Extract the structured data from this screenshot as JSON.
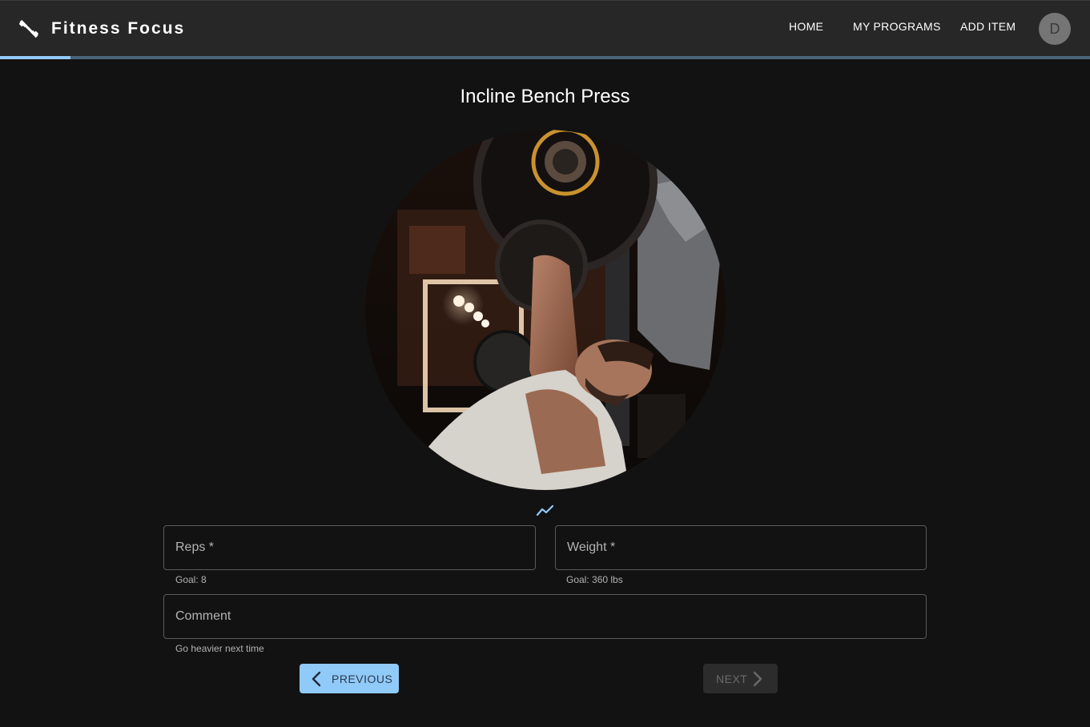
{
  "app": {
    "title": "Fitness Focus",
    "icon": "dumbbell-icon",
    "progress_fraction": 0.065
  },
  "nav": {
    "home": "HOME",
    "programs": "MY PROGRAMS",
    "add_item": "ADD ITEM",
    "avatar_initial": "D"
  },
  "exercise": {
    "title": "Incline Bench Press",
    "image_icon": "bench-press-photo",
    "chart_icon": "trending-chart-icon"
  },
  "form": {
    "reps_label": "Reps *",
    "reps_helper": "Goal: 8",
    "weight_label": "Weight *",
    "weight_helper": "Goal: 360 lbs",
    "comment_label": "Comment",
    "comment_helper": "Go heavier next time"
  },
  "buttons": {
    "previous": "PREVIOUS",
    "next": "NEXT"
  },
  "colors": {
    "accent": "#90caf9",
    "appbar": "#272727",
    "background": "#121212"
  }
}
